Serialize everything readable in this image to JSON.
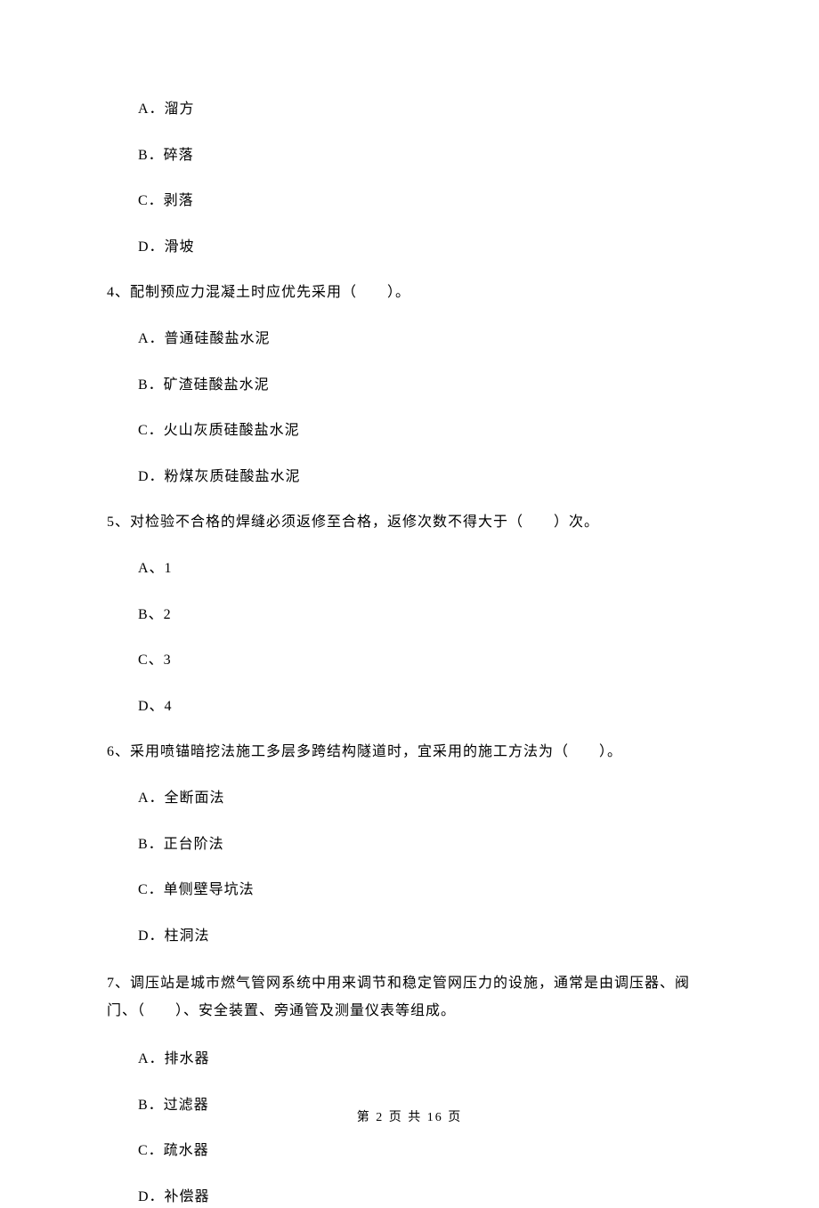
{
  "q3": {
    "options": {
      "a": "A．溜方",
      "b": "B．碎落",
      "c": "C．剥落",
      "d": "D．滑坡"
    }
  },
  "q4": {
    "text": "4、配制预应力混凝土时应优先采用（　　）。",
    "options": {
      "a": "A．普通硅酸盐水泥",
      "b": "B．矿渣硅酸盐水泥",
      "c": "C．火山灰质硅酸盐水泥",
      "d": "D．粉煤灰质硅酸盐水泥"
    }
  },
  "q5": {
    "text": "5、对检验不合格的焊缝必须返修至合格，返修次数不得大于（　　）次。",
    "options": {
      "a": "A、1",
      "b": "B、2",
      "c": "C、3",
      "d": "D、4"
    }
  },
  "q6": {
    "text": "6、采用喷锚暗挖法施工多层多跨结构隧道时，宜采用的施工方法为（　　）。",
    "options": {
      "a": "A．全断面法",
      "b": "B．正台阶法",
      "c": "C．单侧壁导坑法",
      "d": "D．柱洞法"
    }
  },
  "q7": {
    "text": "7、调压站是城市燃气管网系统中用来调节和稳定管网压力的设施，通常是由调压器、阀门、（　　）、安全装置、旁通管及测量仪表等组成。",
    "options": {
      "a": "A．排水器",
      "b": "B．过滤器",
      "c": "C．疏水器",
      "d": "D．补偿器"
    }
  },
  "footer": "第 2 页 共 16 页"
}
